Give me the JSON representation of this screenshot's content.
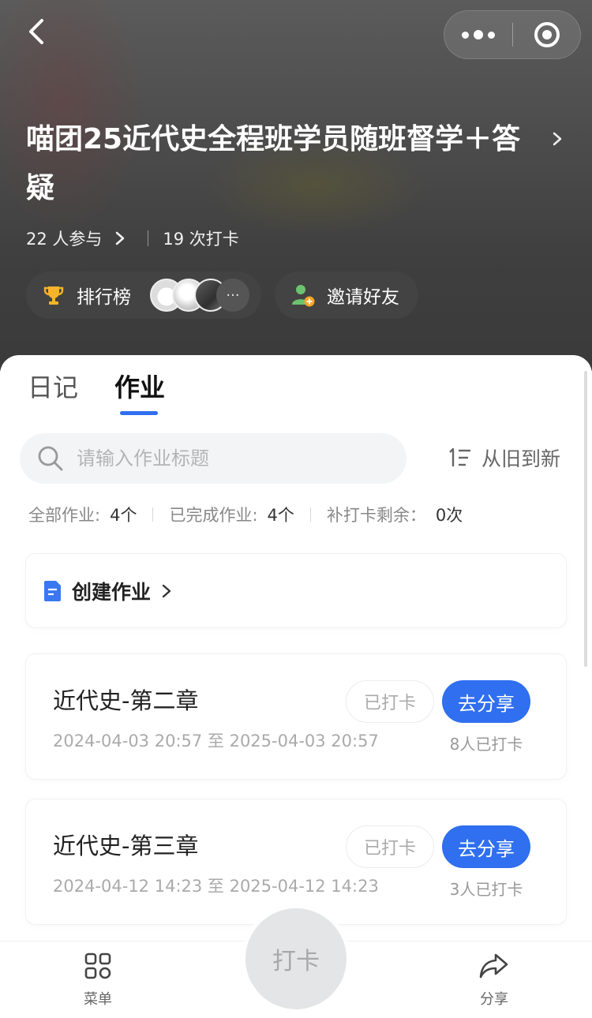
{
  "header": {
    "title": "喵团25近代史全程班学员随班督学＋答疑",
    "participants": "22 人参与",
    "checkins": "19 次打卡",
    "rank_label": "排行榜",
    "avatars_more": "···",
    "invite_label": "邀请好友"
  },
  "tabs": [
    {
      "label": "日记"
    },
    {
      "label": "作业"
    }
  ],
  "search": {
    "placeholder": "请输入作业标题"
  },
  "sort": {
    "label": "从旧到新"
  },
  "counts": {
    "all_label": "全部作业:",
    "all_value": "4个",
    "done_label": "已完成作业:",
    "done_value": "4个",
    "makeup_label": "补打卡剩余：",
    "makeup_value": "0次"
  },
  "create": {
    "label": "创建作业"
  },
  "homework": [
    {
      "title": "近代史-第二章",
      "date": "2024-04-03 20:57 至 2025-04-03 20:57",
      "status": "已打卡",
      "action": "去分享",
      "checked_count": "8人已打卡"
    },
    {
      "title": "近代史-第三章",
      "date": "2024-04-12 14:23 至 2025-04-12 14:23",
      "status": "已打卡",
      "action": "去分享",
      "checked_count": "3人已打卡"
    }
  ],
  "bottom_bar": {
    "menu_label": "菜单",
    "checkin_label": "打卡",
    "share_label": "分享"
  },
  "colors": {
    "accent": "#2f6ff0",
    "header_bg": "#4a4a4a"
  }
}
